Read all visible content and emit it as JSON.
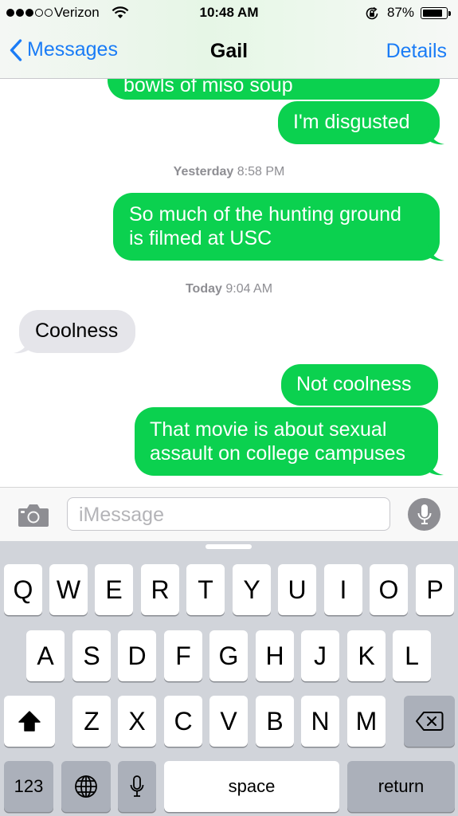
{
  "status_bar": {
    "carrier": "Verizon",
    "time": "10:48 AM",
    "battery_percent": "87%",
    "battery_level": 0.87,
    "signal_bars_filled": 3,
    "signal_bars_total": 5
  },
  "nav": {
    "back_label": "Messages",
    "title": "Gail",
    "details_label": "Details"
  },
  "messages": {
    "m1": "bowls of miso soup",
    "m2": "I'm disgusted",
    "stamp1_day": "Yesterday",
    "stamp1_time": "8:58 PM",
    "m3_line1": "So much of the hunting ground",
    "m3_line2": "is filmed at USC",
    "stamp2_day": "Today",
    "stamp2_time": "9:04 AM",
    "m4": "Coolness",
    "m5": "Not coolness",
    "m6_line1": "That movie is about sexual",
    "m6_line2": "assault on college campuses"
  },
  "input_bar": {
    "placeholder": "iMessage",
    "value": ""
  },
  "keyboard": {
    "row1": [
      "Q",
      "W",
      "E",
      "R",
      "T",
      "Y",
      "U",
      "I",
      "O",
      "P"
    ],
    "row2": [
      "A",
      "S",
      "D",
      "F",
      "G",
      "H",
      "J",
      "K",
      "L"
    ],
    "row3": [
      "Z",
      "X",
      "C",
      "V",
      "B",
      "N",
      "M"
    ],
    "numbers_key": "123",
    "space_key": "space",
    "return_key": "return"
  },
  "colors": {
    "sent_bubble": "#0bd14f",
    "received_bubble": "#e5e5ea",
    "accent_blue": "#1a7cf6",
    "keyboard_bg": "#d1d4da"
  },
  "icons": [
    "wifi-icon",
    "rotation-lock-icon",
    "battery-icon",
    "back-chevron-icon",
    "camera-icon",
    "microphone-icon",
    "shift-icon",
    "delete-icon",
    "globe-icon",
    "dictation-icon"
  ]
}
